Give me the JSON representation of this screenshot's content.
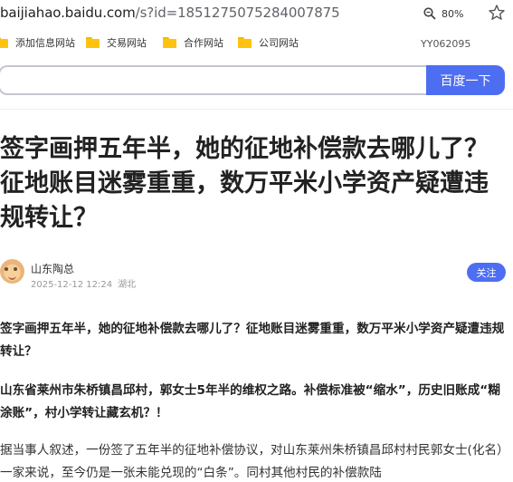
{
  "browser": {
    "url_host": "baijiahao.baidu.com",
    "url_path": "/s?id=1851275075284007875",
    "zoom": "80%"
  },
  "bookmarks": {
    "items": [
      {
        "label": "添加信息网站"
      },
      {
        "label": "交易网站"
      },
      {
        "label": "合作网站"
      },
      {
        "label": "公司网站"
      }
    ],
    "extra_label": "YY062095"
  },
  "search": {
    "value": "",
    "button_label": "百度一下"
  },
  "article": {
    "title": "签字画押五年半，她的征地补偿款去哪儿了？征地账目迷雾重重，数万平米小学资产疑遭违规转让？",
    "author": "山东陶总",
    "date": "2025-12-12 12:24",
    "location": "湖北",
    "follow_label": "关注",
    "paragraphs": [
      "签字画押五年半，她的征地补偿款去哪儿了？征地账目迷雾重重，数万平米小学资产疑遭违规转让？",
      "山东省莱州市朱桥镇昌邱村，郭女士5年半的维权之路。补偿标准被“缩水”，历史旧账成“糊涂账”，村小学转让藏玄机？！",
      "据当事人叙述，一份签了五年半的征地补偿协议，对山东莱州朱桥镇昌邱村村民郭女士(化名）一家来说，至今仍是一张未能兑现的“白条”。同村其他村民的补偿款陆"
    ]
  },
  "colors": {
    "accent": "#4e6ef2",
    "folder": "#ffc20e",
    "meta_text": "#999999"
  }
}
